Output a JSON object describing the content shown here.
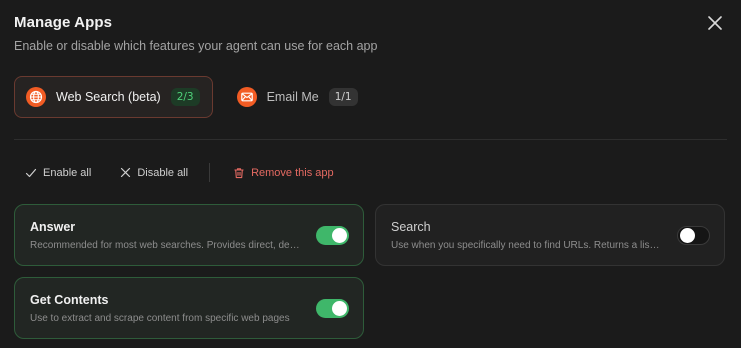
{
  "header": {
    "title": "Manage Apps",
    "subtitle": "Enable or disable which features your agent can use for each app"
  },
  "tabs": [
    {
      "label": "Web Search (beta)",
      "badge": "2/3",
      "icon": "globe-icon",
      "active": true
    },
    {
      "label": "Email Me",
      "badge": "1/1",
      "icon": "mail-icon",
      "active": false
    }
  ],
  "actions": {
    "enable_all": "Enable all",
    "disable_all": "Disable all",
    "remove": "Remove this app"
  },
  "features": [
    {
      "title": "Answer",
      "description": "Recommended for most web searches. Provides direct, detailed answers with citations",
      "enabled": true
    },
    {
      "title": "Search",
      "description": "Use when you specifically need to find URLs. Returns a list of search results",
      "enabled": false
    },
    {
      "title": "Get Contents",
      "description": "Use to extract and scrape content from specific web pages",
      "enabled": true
    }
  ],
  "colors": {
    "accent_orange": "#f25c24",
    "toggle_on": "#3fb76a",
    "danger": "#e56a62",
    "badge_green_text": "#4fd27a"
  }
}
